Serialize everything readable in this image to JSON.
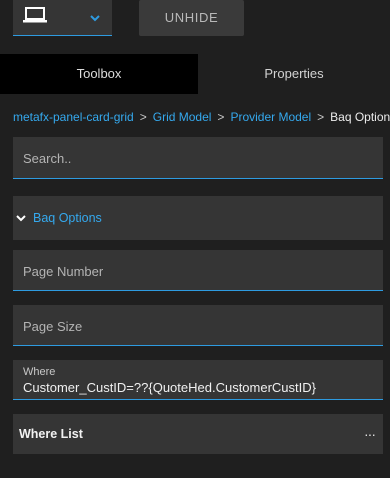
{
  "toolbar": {
    "device_icon": "laptop-icon",
    "dropdown_icon": "chevron-down-icon",
    "unhide_label": "UNHIDE"
  },
  "tabs": [
    {
      "label": "Toolbox",
      "active": true
    },
    {
      "label": "Properties",
      "active": false
    }
  ],
  "breadcrumb": {
    "items": [
      "metafx-panel-card-grid",
      "Grid Model",
      "Provider Model"
    ],
    "current": "Baq Options",
    "separator": ">"
  },
  "search": {
    "placeholder": "Search.."
  },
  "section": {
    "label": "Baq Options",
    "expanded": true
  },
  "fields": {
    "page_number": {
      "placeholder": "Page Number",
      "value": ""
    },
    "page_size": {
      "placeholder": "Page Size",
      "value": ""
    },
    "where": {
      "label": "Where",
      "value": "Customer_CustID=??{QuoteHed.CustomerCustID}"
    }
  },
  "where_list": {
    "label": "Where List",
    "more": "···"
  },
  "colors": {
    "accent": "#35a9ee",
    "panel": "#353535",
    "background": "#1f1f1f"
  }
}
